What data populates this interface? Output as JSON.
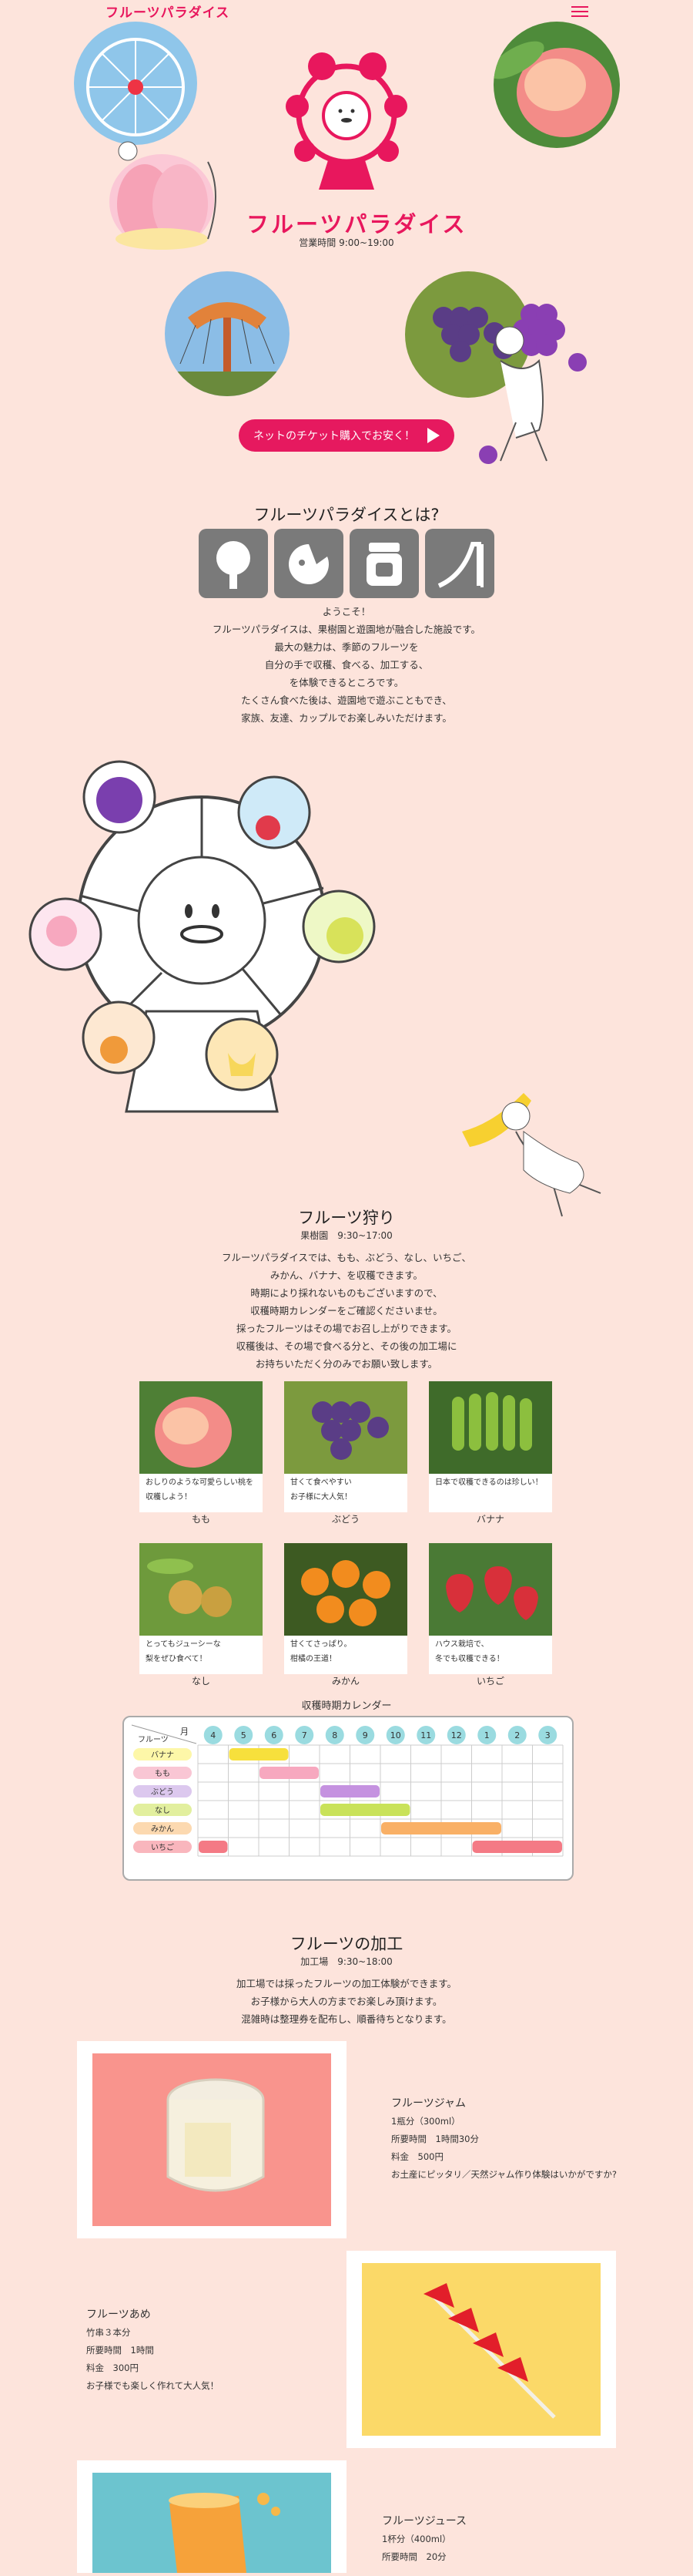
{
  "header": {
    "logo": "フルーツパラダイス",
    "menu_icon": "hamburger-icon"
  },
  "hero": {
    "title": "フルーツパラダイス",
    "hours": "営業時間 9:00~19:00",
    "cta_label": "ネットのチケット購入でお安く！"
  },
  "about": {
    "title": "フルーツパラダイスとは?",
    "icons": [
      "tree-icon",
      "bite-fruit-icon",
      "jam-jar-icon",
      "slide-icon"
    ],
    "lines": [
      "ようこそ！",
      "フルーツパラダイスは、果樹園と遊園地が融合した施設です。",
      "最大の魅力は、季節のフルーツを",
      "自分の手で収穫、食べる、加工する、",
      "を体験できるところです。",
      "たくさん食べた後は、遊園地で遊ぶこともでき、",
      "家族、友達、カップルでお楽しみいただけます。"
    ]
  },
  "picking": {
    "title": "フルーツ狩り",
    "hours": "果樹園　9:30~17:00",
    "lines": [
      "フルーツパラダイスでは、もも、ぶどう、なし、いちご、",
      "みかん、バナナ、を収穫できます。",
      "時期により採れないものもございますので、",
      "収穫時期カレンダーをご確認くださいませ。",
      "採ったフルーツはその場でお召し上がりできます。",
      "収穫後は、その場で食べる分と、その後の加工場に",
      "お持ちいただく分のみでお願い致します。"
    ],
    "fruits": [
      {
        "name": "もも",
        "desc1": "おしりのような可愛らしい桃を",
        "desc2": "収穫しよう！",
        "color": "#f4a28c"
      },
      {
        "name": "ぶどう",
        "desc1": "甘くて食べやすい",
        "desc2": "お子様に大人気！",
        "color": "#6a4b8c"
      },
      {
        "name": "バナナ",
        "desc1": "日本で収穫できるのは珍しい！",
        "desc2": "",
        "color": "#7aa23c"
      },
      {
        "name": "なし",
        "desc1": "とってもジューシーな",
        "desc2": "梨をぜひ食べて！",
        "color": "#a8b84a"
      },
      {
        "name": "みかん",
        "desc1": "甘くてさっぱり。",
        "desc2": "柑橘の王道！",
        "color": "#e98a1e"
      },
      {
        "name": "いちご",
        "desc1": "ハウス栽培で、",
        "desc2": "冬でも収穫できる！",
        "color": "#d8303a"
      }
    ]
  },
  "calendar": {
    "title": "収穫時期カレンダー",
    "corner_fruit": "フルーツ",
    "corner_month": "月",
    "months": [
      "4",
      "5",
      "6",
      "7",
      "8",
      "9",
      "10",
      "11",
      "12",
      "1",
      "2",
      "3"
    ],
    "rows": [
      {
        "label": "バナナ",
        "label_color": "#fdf7a8",
        "bar_color": "#f7e03c",
        "start": 1,
        "end": 3
      },
      {
        "label": "もも",
        "label_color": "#f9c6d4",
        "bar_color": "#f7a8bf",
        "start": 2,
        "end": 4
      },
      {
        "label": "ぶどう",
        "label_color": "#dcc8ee",
        "bar_color": "#c592e0",
        "start": 4,
        "end": 6
      },
      {
        "label": "なし",
        "label_color": "#e2ef9e",
        "bar_color": "#c9e25a",
        "start": 4,
        "end": 7
      },
      {
        "label": "みかん",
        "label_color": "#fcd9b0",
        "bar_color": "#f9b066",
        "start": 6,
        "end": 10
      },
      {
        "label": "いちご",
        "label_color": "#f9b6bd",
        "bar_color": "#f47a85",
        "segments": [
          [
            0,
            1
          ],
          [
            9,
            12
          ]
        ]
      }
    ]
  },
  "processing": {
    "title": "フルーツの加工",
    "hours": "加工場　9:30~18:00",
    "lines": [
      "加工場では採ったフルーツの加工体験ができます。",
      "お子様から大人の方までお楽しみ頂けます。",
      "混雑時は整理券を配布し、順番待ちとなります。"
    ],
    "items": [
      {
        "title": "フルーツジャム",
        "l1": "1瓶分（300ml）",
        "l2": "所要時間　1時間30分",
        "l3": "料金　500円",
        "l4": "お土産にピッタリ／天然ジャム作り体験はいかがですか?",
        "bg": "#f9948d"
      },
      {
        "title": "フルーツあめ",
        "l1": "竹串３本分",
        "l2": "所要時間　1時間",
        "l3": "料金　300円",
        "l4": "お子様でも楽しく作れて大人気！",
        "bg": "#fbd968"
      },
      {
        "title": "フルーツジュース",
        "l1": "1杯分（400ml）",
        "l2": "所要時間　20分",
        "bg": "#6cc4cf"
      }
    ]
  }
}
